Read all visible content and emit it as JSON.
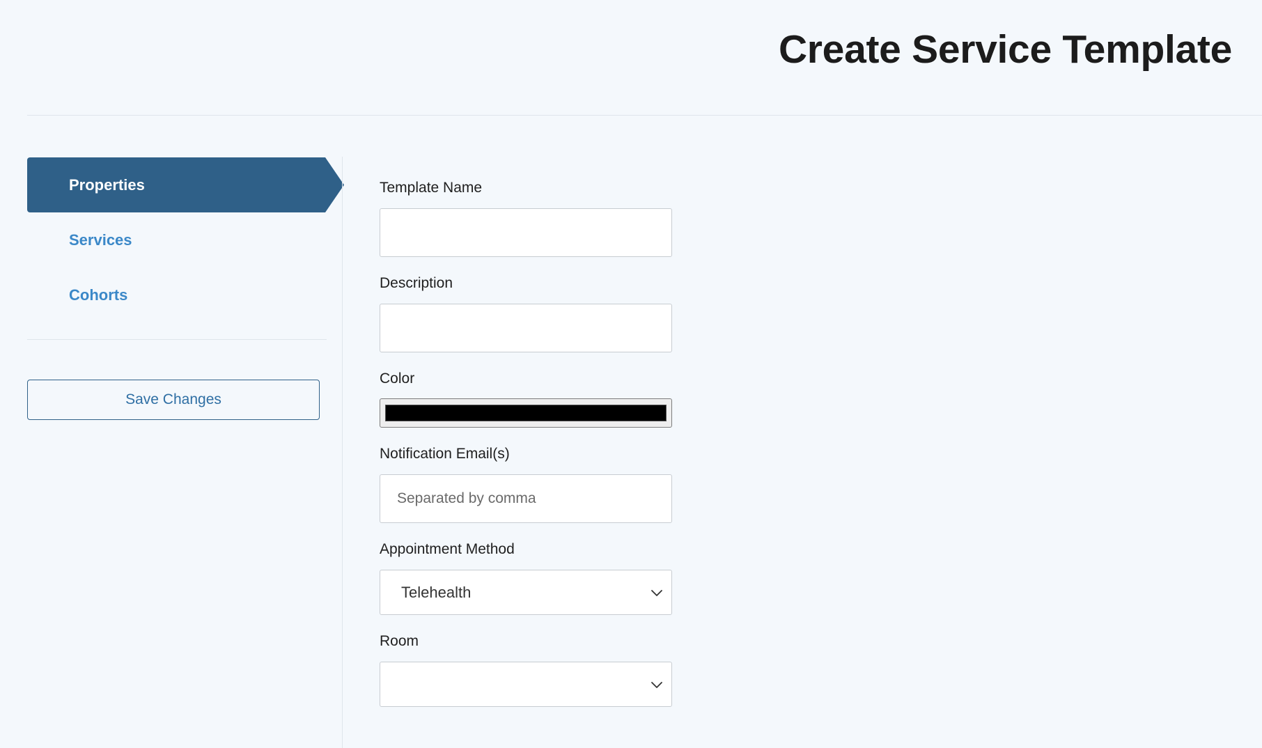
{
  "header": {
    "title": "Create Service Template"
  },
  "sidebar": {
    "items": [
      {
        "label": "Properties",
        "active": true
      },
      {
        "label": "Services",
        "active": false
      },
      {
        "label": "Cohorts",
        "active": false
      }
    ],
    "save_label": "Save Changes"
  },
  "form": {
    "template_name": {
      "label": "Template Name",
      "value": ""
    },
    "description": {
      "label": "Description",
      "value": ""
    },
    "color": {
      "label": "Color",
      "value": "#000000"
    },
    "notification_emails": {
      "label": "Notification Email(s)",
      "value": "",
      "placeholder": "Separated by comma"
    },
    "appointment_method": {
      "label": "Appointment Method",
      "selected": "Telehealth",
      "icon": "chevron-down-icon"
    },
    "room": {
      "label": "Room",
      "selected": "",
      "icon": "chevron-down-icon"
    }
  },
  "colors": {
    "accent": "#2f6088",
    "link": "#3b88c8",
    "background": "#f4f8fc"
  }
}
